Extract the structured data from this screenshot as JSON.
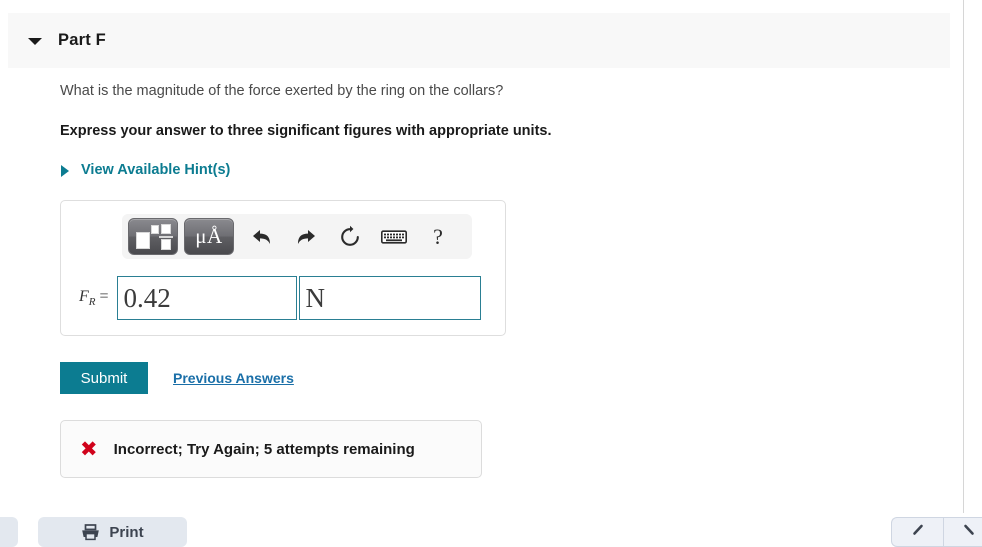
{
  "part": {
    "title": "Part F",
    "toggle_icon": "triangle-down-icon"
  },
  "question": {
    "prompt": "What is the magnitude of the force exerted by the ring on the collars?",
    "instruction": "Express your answer to three significant figures with appropriate units."
  },
  "hints": {
    "label": "View Available Hint(s)",
    "caret_icon": "triangle-right-icon",
    "color": "#0c7c91"
  },
  "answer": {
    "variable_label": "F",
    "variable_subscript": "R",
    "equals": " =",
    "value": "0.42",
    "unit": "N",
    "value_placeholder": "",
    "unit_placeholder": "",
    "border_color": "#2a7f93"
  },
  "toolbar": {
    "buttons": [
      {
        "name": "math-template-button",
        "icon": "math-template-icon",
        "label": ""
      },
      {
        "name": "units-button",
        "icon": "micro-angstrom-icon",
        "label": "μÅ"
      },
      {
        "name": "undo-button",
        "icon": "undo-arrow-icon",
        "label": ""
      },
      {
        "name": "redo-button",
        "icon": "redo-arrow-icon",
        "label": ""
      },
      {
        "name": "reset-button",
        "icon": "refresh-circle-icon",
        "label": ""
      },
      {
        "name": "keyboard-button",
        "icon": "keyboard-icon",
        "label": ""
      },
      {
        "name": "help-button",
        "icon": "question-mark-icon",
        "label": "?"
      }
    ]
  },
  "actions": {
    "submit_label": "Submit",
    "submit_color": "#0c7c91",
    "previous_answers_label": "Previous Answers",
    "previous_answers_color": "#1a6fa8"
  },
  "feedback": {
    "status_icon": "red-x-icon",
    "status_color": "#d0021b",
    "message": "Incorrect; Try Again; 5 attempts remaining"
  },
  "bottom_bar": {
    "print_label": "Print",
    "print_icon": "printer-icon",
    "nav_prev_icon": "chevron-left-icon",
    "nav_next_icon": "chevron-right-icon"
  }
}
